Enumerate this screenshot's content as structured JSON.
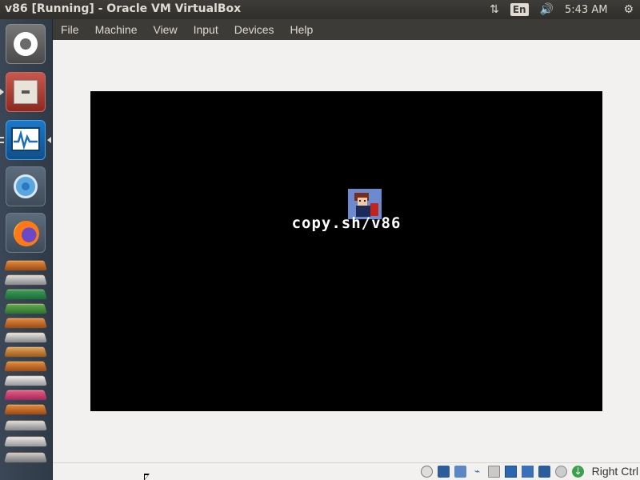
{
  "top_panel": {
    "window_title": "v86 [Running] - Oracle VM VirtualBox",
    "network_icon": "network-arrows-icon",
    "keyboard_layout": "En",
    "volume_icon": "volume-icon",
    "clock": "5:43 AM",
    "settings_icon": "gear-icon"
  },
  "launcher": {
    "items": [
      {
        "name": "ubuntu-dash",
        "icon": "ubuntu-logo-icon"
      },
      {
        "name": "files",
        "icon": "file-cabinet-icon"
      },
      {
        "name": "system-monitor",
        "icon": "system-monitor-icon"
      },
      {
        "name": "chromium",
        "icon": "chromium-icon"
      },
      {
        "name": "firefox",
        "icon": "firefox-icon"
      }
    ]
  },
  "menubar": {
    "file": "File",
    "machine": "Machine",
    "view": "View",
    "input": "Input",
    "devices": "Devices",
    "help": "Help"
  },
  "guest": {
    "splash_text": "copy.sh/v86",
    "splash_icon": "v86-mascot-icon"
  },
  "statusbar": {
    "icons": [
      "optical-disk-icon",
      "floppy-icon",
      "network-icon",
      "usb-icon",
      "shared-folder-icon",
      "display-icon",
      "video-capture-icon",
      "cpu-icon",
      "mouse-integration-icon",
      "host-key-indicator-icon"
    ],
    "host_key": "Right Ctrl"
  },
  "colors": {
    "panel": "#3c3b37",
    "launcher": "#33404e",
    "window_bg": "#f2f1f0",
    "guest_bg": "#000000"
  }
}
